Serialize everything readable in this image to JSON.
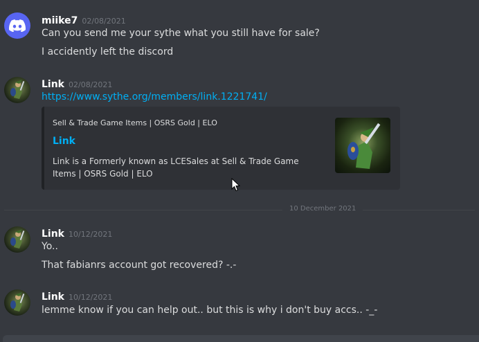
{
  "messages": [
    {
      "username": "miike7",
      "timestamp": "02/08/2021",
      "avatar": "discord-logo-icon",
      "lines": [
        "Can you send me your sythe what you still have for sale?",
        "I accidently left the discord"
      ]
    },
    {
      "username": "Link",
      "timestamp": "02/08/2021",
      "avatar": "link-avatar",
      "lines": [
        "https://www.sythe.org/members/link.1221741/"
      ],
      "embed": {
        "provider": "Sell & Trade Game Items | OSRS Gold | ELO",
        "title": "Link",
        "description": "Link is a Formerly known as LCESales at Sell & Trade Game Items | OSRS Gold | ELO"
      }
    },
    {
      "username": "Link",
      "timestamp": "10/12/2021",
      "avatar": "link-avatar",
      "lines": [
        "Yo..",
        "That fabianrs account got recovered? -.-"
      ]
    },
    {
      "username": "Link",
      "timestamp": "10/12/2021",
      "avatar": "link-avatar",
      "lines": [
        "lemme know if you can help out.. but this is why i don't buy accs.. -_-"
      ]
    }
  ],
  "date_divider": "10 December 2021",
  "colors": {
    "background": "#36393f",
    "link": "#00aff4",
    "blurple": "#5865f2",
    "muted": "#72767d"
  }
}
